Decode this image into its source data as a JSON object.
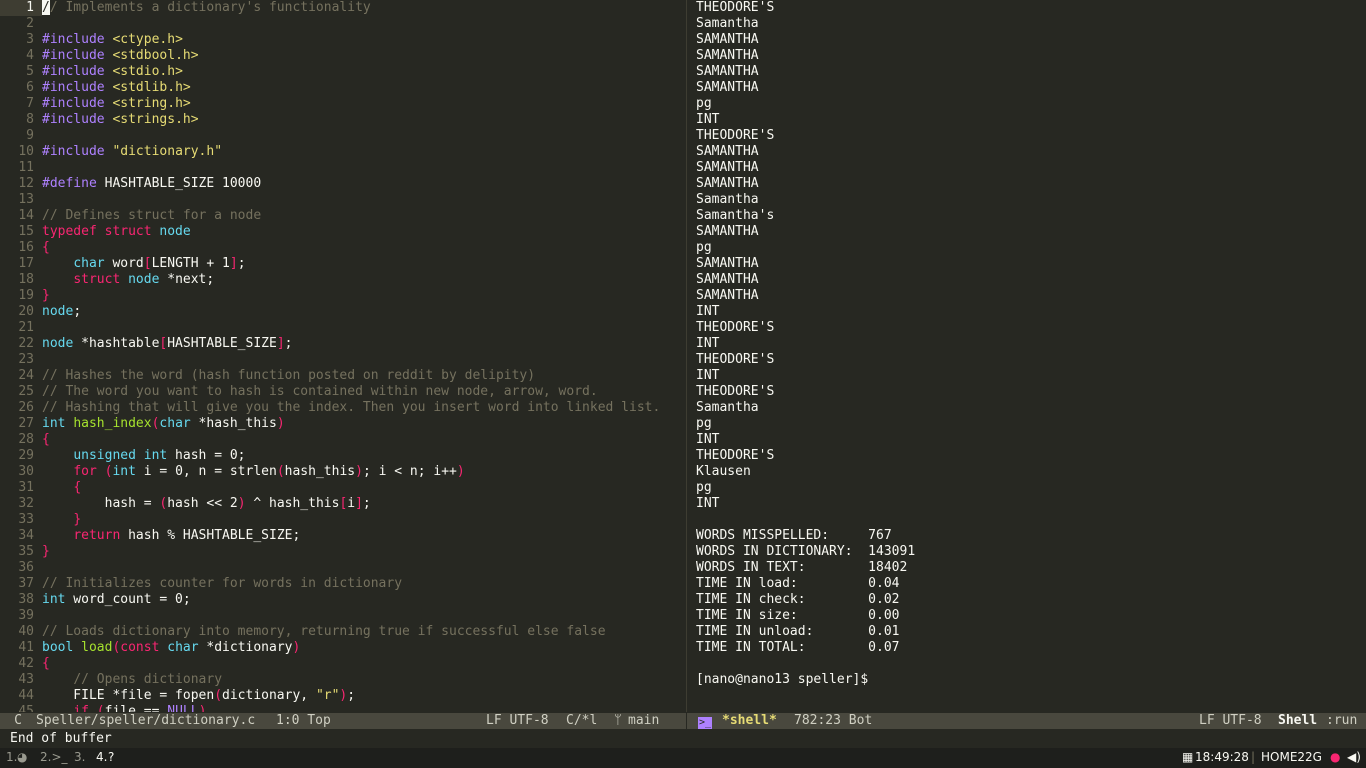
{
  "editor": {
    "lines": [
      [
        [
          "comment",
          "// Implements a dictionary's functionality"
        ]
      ],
      [],
      [
        [
          "macro",
          "#include "
        ],
        [
          "str",
          "<ctype.h>"
        ]
      ],
      [
        [
          "macro",
          "#include "
        ],
        [
          "str",
          "<stdbool.h>"
        ]
      ],
      [
        [
          "macro",
          "#include "
        ],
        [
          "str",
          "<stdio.h>"
        ]
      ],
      [
        [
          "macro",
          "#include "
        ],
        [
          "str",
          "<stdlib.h>"
        ]
      ],
      [
        [
          "macro",
          "#include "
        ],
        [
          "str",
          "<string.h>"
        ]
      ],
      [
        [
          "macro",
          "#include "
        ],
        [
          "str",
          "<strings.h>"
        ]
      ],
      [],
      [
        [
          "macro",
          "#include "
        ],
        [
          "str",
          "\"dictionary.h\""
        ]
      ],
      [],
      [
        [
          "macro",
          "#define "
        ],
        [
          "plain",
          "HASHTABLE_SIZE 10000"
        ]
      ],
      [],
      [
        [
          "comment",
          "// Defines struct for a node"
        ]
      ],
      [
        [
          "kw",
          "typedef struct "
        ],
        [
          "type",
          "node"
        ]
      ],
      [
        [
          "br",
          "{"
        ]
      ],
      [
        [
          "plain",
          "    "
        ],
        [
          "type",
          "char"
        ],
        [
          "plain",
          " word"
        ],
        [
          "br",
          "["
        ],
        [
          "plain",
          "LENGTH + 1"
        ],
        [
          "br",
          "]"
        ],
        [
          "plain",
          ";"
        ]
      ],
      [
        [
          "plain",
          "    "
        ],
        [
          "kw",
          "struct "
        ],
        [
          "type",
          "node"
        ],
        [
          "plain",
          " *next;"
        ]
      ],
      [
        [
          "br",
          "}"
        ]
      ],
      [
        [
          "type",
          "node"
        ],
        [
          "plain",
          ";"
        ]
      ],
      [],
      [
        [
          "type",
          "node"
        ],
        [
          "plain",
          " *hashtable"
        ],
        [
          "br",
          "["
        ],
        [
          "plain",
          "HASHTABLE_SIZE"
        ],
        [
          "br",
          "]"
        ],
        [
          "plain",
          ";"
        ]
      ],
      [],
      [
        [
          "comment",
          "// Hashes the word (hash function posted on reddit by delipity)"
        ]
      ],
      [
        [
          "comment",
          "// The word you want to hash is contained within new node, arrow, word."
        ]
      ],
      [
        [
          "comment",
          "// Hashing that will give you the index. Then you insert word into linked list."
        ]
      ],
      [
        [
          "type",
          "int"
        ],
        [
          "plain",
          " "
        ],
        [
          "fn",
          "hash_index"
        ],
        [
          "br",
          "("
        ],
        [
          "type",
          "char"
        ],
        [
          "plain",
          " *hash_this"
        ],
        [
          "br",
          ")"
        ]
      ],
      [
        [
          "br",
          "{"
        ]
      ],
      [
        [
          "plain",
          "    "
        ],
        [
          "type",
          "unsigned int"
        ],
        [
          "plain",
          " hash = 0;"
        ]
      ],
      [
        [
          "plain",
          "    "
        ],
        [
          "kw",
          "for"
        ],
        [
          "plain",
          " "
        ],
        [
          "br",
          "("
        ],
        [
          "type",
          "int"
        ],
        [
          "plain",
          " i = 0, n = strlen"
        ],
        [
          "br",
          "("
        ],
        [
          "plain",
          "hash_this"
        ],
        [
          "br",
          ")"
        ],
        [
          "plain",
          "; i < n; i++"
        ],
        [
          "br",
          ")"
        ]
      ],
      [
        [
          "plain",
          "    "
        ],
        [
          "br",
          "{"
        ]
      ],
      [
        [
          "plain",
          "        hash = "
        ],
        [
          "br",
          "("
        ],
        [
          "plain",
          "hash << 2"
        ],
        [
          "br",
          ")"
        ],
        [
          "plain",
          " ^ hash_this"
        ],
        [
          "br",
          "["
        ],
        [
          "plain",
          "i"
        ],
        [
          "br",
          "]"
        ],
        [
          "plain",
          ";"
        ]
      ],
      [
        [
          "plain",
          "    "
        ],
        [
          "br",
          "}"
        ]
      ],
      [
        [
          "plain",
          "    "
        ],
        [
          "kw",
          "return"
        ],
        [
          "plain",
          " hash % HASHTABLE_SIZE;"
        ]
      ],
      [
        [
          "br",
          "}"
        ]
      ],
      [],
      [
        [
          "comment",
          "// Initializes counter for words in dictionary"
        ]
      ],
      [
        [
          "type",
          "int"
        ],
        [
          "plain",
          " word_count = 0;"
        ]
      ],
      [],
      [
        [
          "comment",
          "// Loads dictionary into memory, returning true if successful else false"
        ]
      ],
      [
        [
          "type",
          "bool"
        ],
        [
          "plain",
          " "
        ],
        [
          "fn",
          "load"
        ],
        [
          "br",
          "("
        ],
        [
          "kw",
          "const "
        ],
        [
          "type",
          "char"
        ],
        [
          "plain",
          " *dictionary"
        ],
        [
          "br",
          ")"
        ]
      ],
      [
        [
          "br",
          "{"
        ]
      ],
      [
        [
          "plain",
          "    "
        ],
        [
          "comment",
          "// Opens dictionary"
        ]
      ],
      [
        [
          "plain",
          "    FILE *file = fopen"
        ],
        [
          "br",
          "("
        ],
        [
          "plain",
          "dictionary, "
        ],
        [
          "str",
          "\"r\""
        ],
        [
          "br",
          ")"
        ],
        [
          "plain",
          ";"
        ]
      ],
      [
        [
          "plain",
          "    "
        ],
        [
          "kw",
          "if"
        ],
        [
          "plain",
          " "
        ],
        [
          "br",
          "("
        ],
        [
          "plain",
          "file == "
        ],
        [
          "macro",
          "NULL"
        ],
        [
          "br",
          ")"
        ]
      ]
    ]
  },
  "shell": {
    "output_lines": [
      "THEODORE'S",
      "Samantha",
      "SAMANTHA",
      "SAMANTHA",
      "SAMANTHA",
      "SAMANTHA",
      "pg",
      "INT",
      "THEODORE'S",
      "SAMANTHA",
      "SAMANTHA",
      "SAMANTHA",
      "Samantha",
      "Samantha's",
      "SAMANTHA",
      "pg",
      "SAMANTHA",
      "SAMANTHA",
      "SAMANTHA",
      "INT",
      "THEODORE'S",
      "INT",
      "THEODORE'S",
      "INT",
      "THEODORE'S",
      "Samantha",
      "pg",
      "INT",
      "THEODORE'S",
      "Klausen",
      "pg",
      "INT",
      "",
      "WORDS MISSPELLED:     767",
      "WORDS IN DICTIONARY:  143091",
      "WORDS IN TEXT:        18402",
      "TIME IN load:         0.04",
      "TIME IN check:        0.02",
      "TIME IN size:         0.00",
      "TIME IN unload:       0.01",
      "TIME IN TOTAL:        0.07",
      "",
      "[nano@nano13 speller]$"
    ]
  },
  "modeline_left": {
    "mode_icon": "C",
    "buffer_path": "Speller/speller/dictionary.c",
    "position": "1:0 Top",
    "encoding": "LF UTF-8",
    "major_mode": "C/*l",
    "branch": "main"
  },
  "modeline_right": {
    "buffer_name": "*shell*",
    "position": "782:23 Bot",
    "encoding": "LF UTF-8",
    "major_mode": "Shell",
    "process": ":run"
  },
  "echo_area": "End of buffer",
  "taskbar": {
    "workspaces": [
      "1.",
      "2.>_",
      "3.",
      "4."
    ],
    "clock": "18:49:28",
    "network": "HOME22G"
  },
  "colors": {
    "background": "#272822",
    "comment": "#75715e",
    "keyword": "#f92672",
    "type": "#66d9ef",
    "function": "#a6e22e",
    "string": "#e6db74",
    "macro": "#ae81ff"
  }
}
